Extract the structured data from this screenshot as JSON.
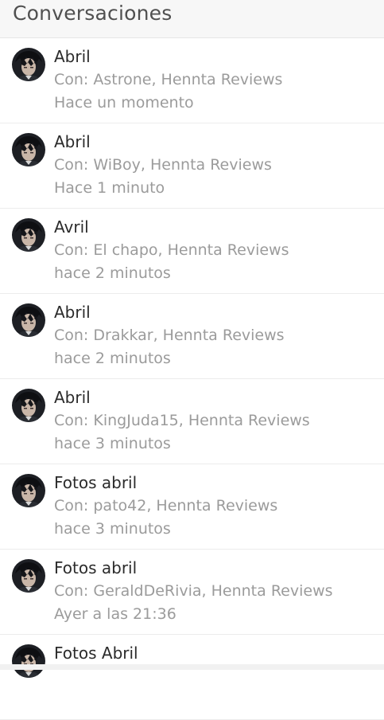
{
  "header": {
    "title": "Conversaciones"
  },
  "conversations": [
    {
      "title": "Abril",
      "participants": "Con: Astrone, Hennta Reviews",
      "time": "Hace un momento"
    },
    {
      "title": "Abril",
      "participants": "Con: WiBoy, Hennta Reviews",
      "time": "Hace 1 minuto"
    },
    {
      "title": "Avril",
      "participants": "Con: El chapo, Hennta Reviews",
      "time": "hace 2 minutos"
    },
    {
      "title": "Abril",
      "participants": "Con: Drakkar, Hennta Reviews",
      "time": "hace 2 minutos"
    },
    {
      "title": "Abril",
      "participants": "Con: KingJuda15, Hennta Reviews",
      "time": "hace 3 minutos"
    },
    {
      "title": "Fotos abril",
      "participants": "Con: pato42, Hennta Reviews",
      "time": "hace 3 minutos"
    },
    {
      "title": "Fotos abril",
      "participants": "Con: GeraldDeRivia, Hennta Reviews",
      "time": "Ayer a las 21:36"
    },
    {
      "title": "Fotos Abril",
      "participants": "",
      "time": ""
    }
  ],
  "icons": {
    "avatar": "user-avatar-icon"
  },
  "colors": {
    "title_text": "#2b2b2b",
    "secondary_text": "#9b9b9b",
    "header_bg": "#f7f7f7"
  }
}
